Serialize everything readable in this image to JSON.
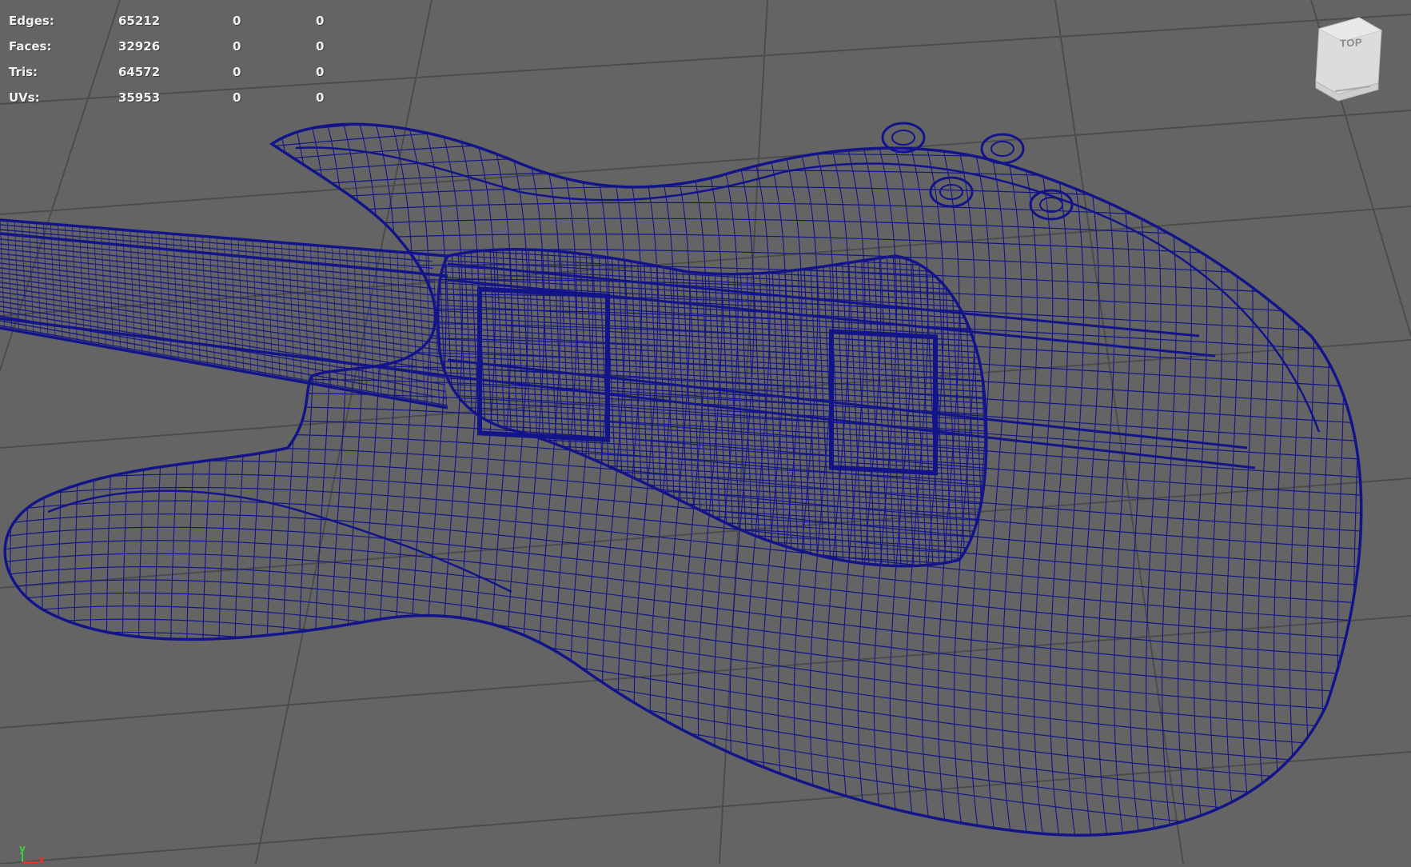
{
  "viewport": {
    "name": "3D perspective viewport",
    "background_color": "#646464",
    "grid_color": "#4c4c4c",
    "wire_color": "#14148a"
  },
  "hud": {
    "rows": [
      {
        "label": "Edges:",
        "total": "65212",
        "selected": "0",
        "component": "0"
      },
      {
        "label": "Faces:",
        "total": "32926",
        "selected": "0",
        "component": "0"
      },
      {
        "label": "Tris:",
        "total": "64572",
        "selected": "0",
        "component": "0"
      },
      {
        "label": "UVs:",
        "total": "35953",
        "selected": "0",
        "component": "0"
      }
    ]
  },
  "viewcube": {
    "face_label": "TOP",
    "icon": "view-cube-icon"
  },
  "axis_gizmo": {
    "y_label": "y",
    "x_label": "x",
    "y_color": "#37d137",
    "x_color": "#e0342d"
  }
}
